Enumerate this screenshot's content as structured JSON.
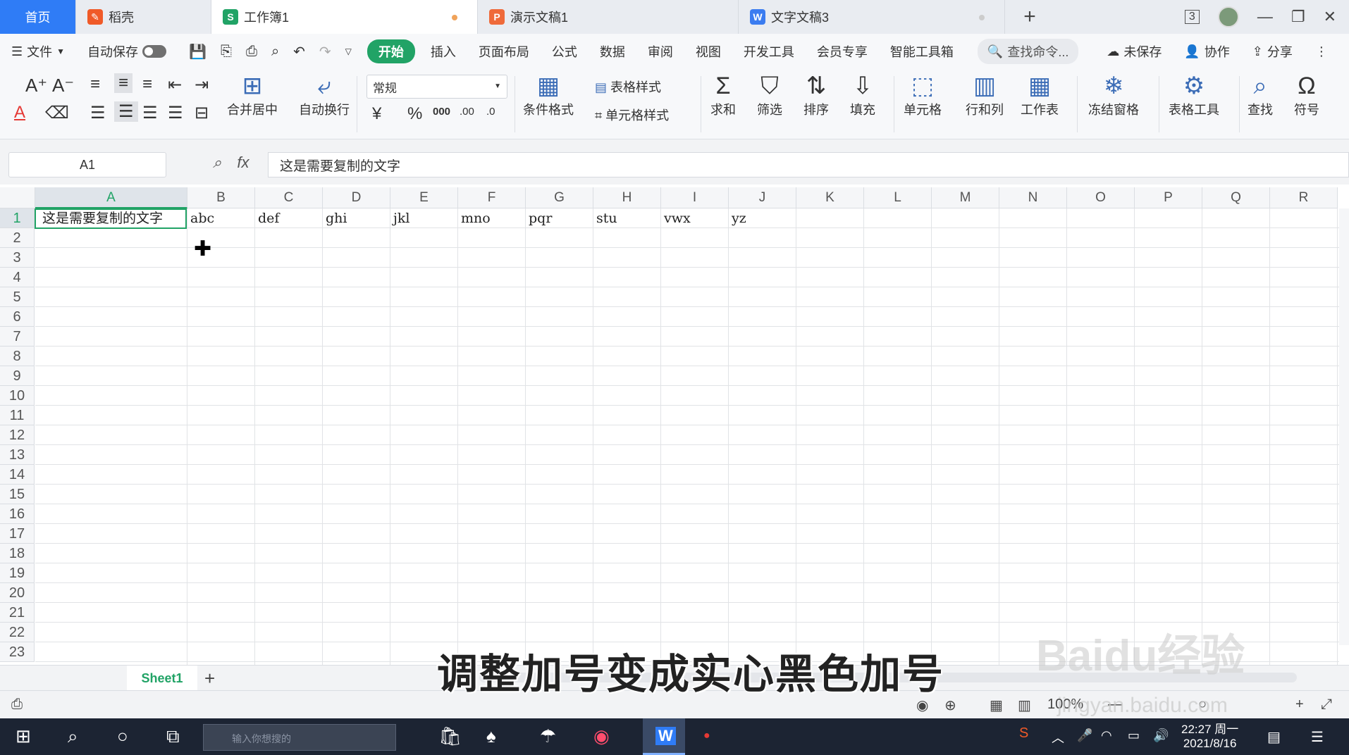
{
  "tabs": {
    "home": "首页",
    "daoke": "稻壳",
    "workbook": "工作簿1",
    "ppt": "演示文稿1",
    "doc": "文字文稿3",
    "window_count": "3"
  },
  "menu": {
    "file": "文件",
    "autosave": "自动保存",
    "items": [
      "开始",
      "插入",
      "页面布局",
      "公式",
      "数据",
      "审阅",
      "视图",
      "开发工具",
      "会员专享",
      "智能工具箱"
    ],
    "search_placeholder": "查找命令...",
    "unsaved": "未保存",
    "collab": "协作",
    "share": "分享"
  },
  "ribbon": {
    "merge_center": "合并居中",
    "auto_wrap": "自动换行",
    "number_format": "常规",
    "table_style": "表格样式",
    "cond_format": "条件格式",
    "cell_style": "单元格样式",
    "sum": "求和",
    "filter": "筛选",
    "sort": "排序",
    "fill": "填充",
    "cell": "单元格",
    "row_col": "行和列",
    "worksheet": "工作表",
    "freeze": "冻结窗格",
    "table_tools": "表格工具",
    "find": "查找",
    "symbol": "符号"
  },
  "formula_bar": {
    "name_box": "A1",
    "content": "这是需要复制的文字"
  },
  "grid": {
    "columns": [
      "A",
      "B",
      "C",
      "D",
      "E",
      "F",
      "G",
      "H",
      "I",
      "J",
      "K",
      "L",
      "M",
      "N",
      "O",
      "P",
      "Q",
      "R"
    ],
    "rows": [
      "1",
      "2",
      "3",
      "4",
      "5",
      "6",
      "7",
      "8",
      "9",
      "10",
      "11",
      "12",
      "13",
      "14",
      "15",
      "16",
      "17",
      "18",
      "19",
      "20",
      "21",
      "22",
      "23"
    ],
    "row1": [
      "这是需要复制的文字",
      "abc",
      "def",
      "ghi",
      "jkl",
      "mno",
      "pqr",
      "stu",
      "vwx",
      "yz"
    ]
  },
  "sheet": {
    "active": "Sheet1"
  },
  "status": {
    "zoom": "100%"
  },
  "overlay": {
    "subtitle": "调整加号变成实心黑色加号",
    "watermark": "Baidu经验",
    "watermark_url": "jingyan.baidu.com"
  },
  "taskbar": {
    "search_placeholder": "输入你想搜的",
    "time": "22:27 周一",
    "date": "2021/8/16"
  },
  "colors": {
    "accent_green": "#21a366",
    "home_blue": "#2f7cf6",
    "taskbar": "#1c2433"
  }
}
